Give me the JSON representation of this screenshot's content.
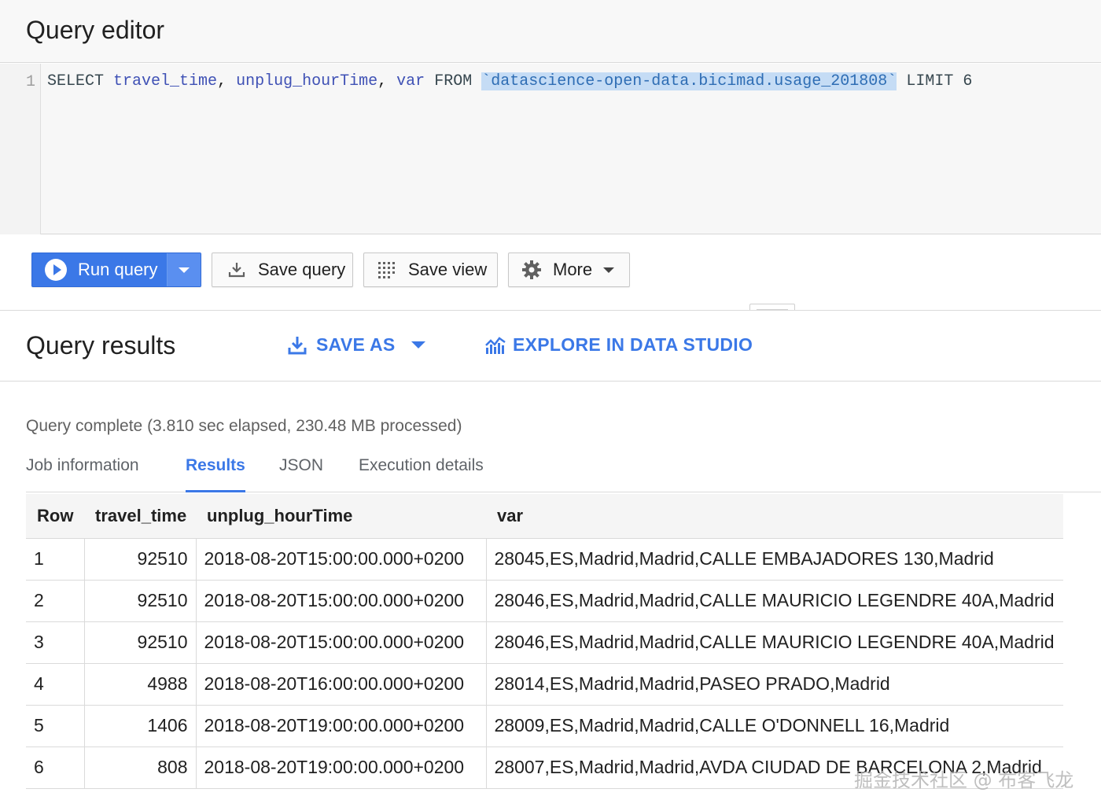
{
  "editor": {
    "title": "Query editor",
    "line_number": "1",
    "code": {
      "select": "SELECT",
      "col1": "travel_time",
      "comma1": ",",
      "col2": "unplug_hourTime",
      "comma2": ",",
      "col3": "var",
      "from": "FROM",
      "table_ref": "`datascience-open-data.bicimad.usage_201808`",
      "limit": "LIMIT",
      "limit_value": "6"
    }
  },
  "toolbar": {
    "run_label": "Run query",
    "save_query_label": "Save query",
    "save_view_label": "Save view",
    "more_label": "More"
  },
  "results": {
    "title": "Query results",
    "save_as_label": "SAVE AS",
    "explore_label": "EXPLORE IN DATA STUDIO",
    "status": "Query complete (3.810 sec elapsed, 230.48 MB processed)",
    "tabs": [
      {
        "label": "Job information",
        "active": false
      },
      {
        "label": "Results",
        "active": true
      },
      {
        "label": "JSON",
        "active": false
      },
      {
        "label": "Execution details",
        "active": false
      }
    ],
    "columns": [
      "Row",
      "travel_time",
      "unplug_hourTime",
      "var"
    ],
    "rows": [
      {
        "row": "1",
        "travel_time": "92510",
        "unplug_hourTime": "2018-08-20T15:00:00.000+0200",
        "var": "28045,ES,Madrid,Madrid,CALLE EMBAJADORES 130,Madrid"
      },
      {
        "row": "2",
        "travel_time": "92510",
        "unplug_hourTime": "2018-08-20T15:00:00.000+0200",
        "var": "28046,ES,Madrid,Madrid,CALLE MAURICIO LEGENDRE 40A,Madrid"
      },
      {
        "row": "3",
        "travel_time": "92510",
        "unplug_hourTime": "2018-08-20T15:00:00.000+0200",
        "var": "28046,ES,Madrid,Madrid,CALLE MAURICIO LEGENDRE 40A,Madrid"
      },
      {
        "row": "4",
        "travel_time": "4988",
        "unplug_hourTime": "2018-08-20T16:00:00.000+0200",
        "var": "28014,ES,Madrid,Madrid,PASEO PRADO,Madrid"
      },
      {
        "row": "5",
        "travel_time": "1406",
        "unplug_hourTime": "2018-08-20T19:00:00.000+0200",
        "var": "28009,ES,Madrid,Madrid,CALLE O'DONNELL 16,Madrid"
      },
      {
        "row": "6",
        "travel_time": "808",
        "unplug_hourTime": "2018-08-20T19:00:00.000+0200",
        "var": "28007,ES,Madrid,Madrid,AVDA CIUDAD DE BARCELONA 2,Madrid"
      }
    ]
  },
  "watermark": "掘金技术社区 @ 布客飞龙",
  "colors": {
    "accent": "#3b78e7",
    "selection": "#c5dcf5",
    "header_bg": "#f8f8f8"
  },
  "icons": [
    "play-icon",
    "caret-down-icon",
    "download-icon",
    "grid-icon",
    "gear-icon",
    "save-as-icon",
    "data-studio-icon"
  ]
}
